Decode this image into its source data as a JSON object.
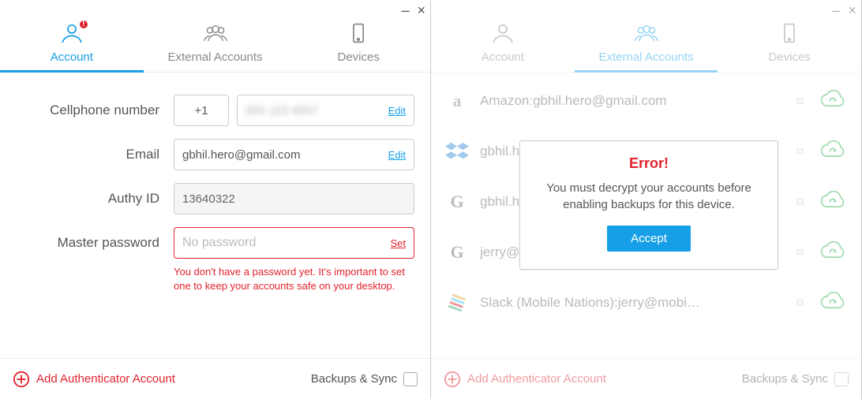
{
  "left": {
    "tabs": {
      "account": "Account",
      "external": "External Accounts",
      "devices": "Devices"
    },
    "fields": {
      "cell_label": "Cellphone number",
      "cell_cc": "+1",
      "cell_value": "555 123 4567",
      "cell_edit": "Edit",
      "email_label": "Email",
      "email_value": "gbhil.hero@gmail.com",
      "email_edit": "Edit",
      "authy_label": "Authy ID",
      "authy_value": "13640322",
      "master_label": "Master password",
      "master_placeholder": "No password",
      "master_set": "Set",
      "master_helper": "You don't have a password yet. It's important to set one to keep your accounts safe on your desktop."
    },
    "bottom": {
      "add": "Add Authenticator Account",
      "backups": "Backups & Sync"
    }
  },
  "right": {
    "tabs": {
      "account": "Account",
      "external": "External Accounts",
      "devices": "Devices"
    },
    "accounts": [
      {
        "label": "Amazon:gbhil.hero@gmail.com"
      },
      {
        "label": "gbhil.hero@gmail.com"
      },
      {
        "label": "gbhil.hero@gmail.com"
      },
      {
        "label": "jerry@smartphoneexperts.com"
      },
      {
        "label": "Slack (Mobile Nations):jerry@mobi…"
      }
    ],
    "modal": {
      "title": "Error!",
      "body": "You must decrypt your accounts before enabling backups for this device.",
      "accept": "Accept"
    },
    "bottom": {
      "add": "Add Authenticator Account",
      "backups": "Backups & Sync"
    }
  }
}
